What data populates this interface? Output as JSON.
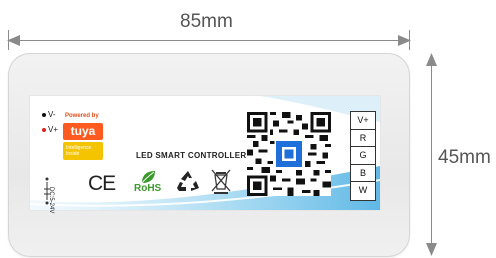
{
  "dimensions": {
    "width_label": "85mm",
    "height_label": "45mm"
  },
  "power": {
    "v_minus": "V-",
    "v_plus": "V+",
    "dc_input": "DC:5-24V"
  },
  "brand": {
    "powered_by": "Powered by",
    "tuya": "tuya",
    "intelligence": "Intelligence Inside"
  },
  "product": {
    "name": "LED SMART CONTROLLER"
  },
  "certifications": {
    "ce": "CE",
    "rohs": "RoHS"
  },
  "terminals": [
    "V+",
    "R",
    "G",
    "B",
    "W"
  ],
  "colors": {
    "tuya_orange": "#ff5a1f",
    "intelligence_yellow": "#f5c400",
    "rohs_green": "#3a9a2a",
    "qr_accent": "#1e6fd9"
  }
}
